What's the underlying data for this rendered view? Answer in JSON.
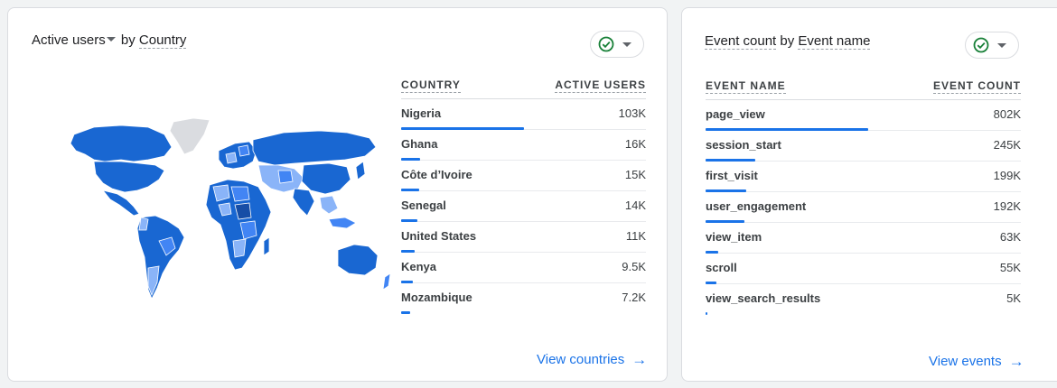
{
  "users_card": {
    "title_metric": "Active users",
    "title_by": "by",
    "title_dimension": "Country",
    "columns": {
      "name": "COUNTRY",
      "value": "ACTIVE USERS"
    },
    "rows": [
      {
        "name": "Nigeria",
        "value": "103K",
        "share": 1.0
      },
      {
        "name": "Ghana",
        "value": "16K",
        "share": 0.155
      },
      {
        "name": "Côte d’Ivoire",
        "value": "15K",
        "share": 0.146
      },
      {
        "name": "Senegal",
        "value": "14K",
        "share": 0.136
      },
      {
        "name": "United States",
        "value": "11K",
        "share": 0.107
      },
      {
        "name": "Kenya",
        "value": "9.5K",
        "share": 0.092
      },
      {
        "name": "Mozambique",
        "value": "7.2K",
        "share": 0.07
      }
    ],
    "link": "View countries"
  },
  "events_card": {
    "title_metric": "Event count",
    "title_by": "by",
    "title_dimension": "Event name",
    "columns": {
      "name": "EVENT NAME",
      "value": "EVENT COUNT"
    },
    "rows": [
      {
        "name": "page_view",
        "value": "802K",
        "share": 1.0
      },
      {
        "name": "session_start",
        "value": "245K",
        "share": 0.305
      },
      {
        "name": "first_visit",
        "value": "199K",
        "share": 0.248
      },
      {
        "name": "user_engagement",
        "value": "192K",
        "share": 0.239
      },
      {
        "name": "view_item",
        "value": "63K",
        "share": 0.079
      },
      {
        "name": "scroll",
        "value": "55K",
        "share": 0.069
      },
      {
        "name": "view_search_results",
        "value": "5K",
        "share": 0.006
      }
    ],
    "link": "View events"
  },
  "colors": {
    "accent": "#1a73e8",
    "map_dark": "#1967d2",
    "map_mid": "#4285f4",
    "map_light": "#8ab4f8",
    "map_none": "#dadce0",
    "status_ok": "#188038"
  },
  "icons": {
    "status": "check-circle-icon",
    "dropdown": "caret-down-icon",
    "link_arrow": "arrow-right-icon"
  }
}
